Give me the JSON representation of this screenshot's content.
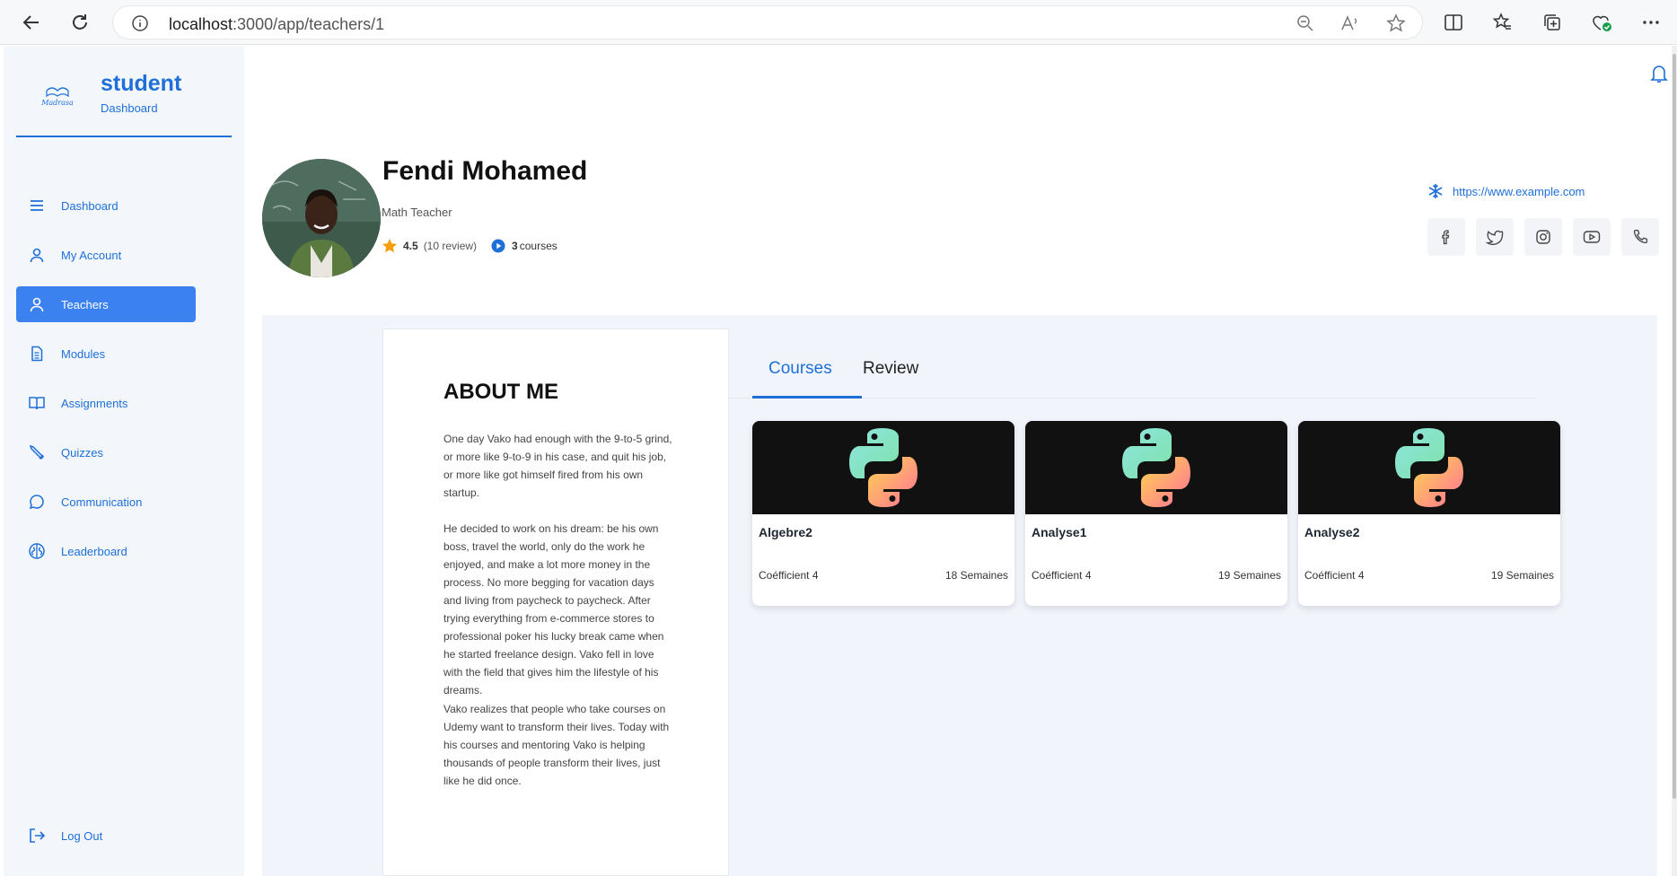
{
  "browser": {
    "url_host": "localhost",
    "url_path": ":3000/app/teachers/1"
  },
  "sidebar": {
    "brand_title": "student",
    "brand_subtitle": "Dashboard",
    "logo_text": "Madrasa",
    "items": [
      {
        "label": "Dashboard",
        "icon": "menu-icon"
      },
      {
        "label": "My Account",
        "icon": "user-icon"
      },
      {
        "label": "Teachers",
        "icon": "user-icon",
        "active": true
      },
      {
        "label": "Modules",
        "icon": "document-icon"
      },
      {
        "label": "Assignments",
        "icon": "book-icon"
      },
      {
        "label": "Quizzes",
        "icon": "pencil-icon"
      },
      {
        "label": "Communication",
        "icon": "chat-icon"
      },
      {
        "label": "Leaderboard",
        "icon": "trophy-icon"
      }
    ],
    "logout_label": "Log Out"
  },
  "teacher": {
    "name": "Fendi Mohamed",
    "role": "Math Teacher",
    "rating": "4.5",
    "reviews": "(10 review)",
    "course_count": "3",
    "courses_label": "courses",
    "website": "https://www.example.com"
  },
  "about": {
    "title": "ABOUT ME",
    "paragraphs": [
      "One day Vako had enough with the 9-to-5 grind, or more like 9-to-9 in his case, and quit his job, or more like got himself fired from his own startup.",
      "He decided to work on his dream: be his own boss, travel the world, only do the work he enjoyed, and make a lot more money in the process. No more begging for vacation days and living from paycheck to paycheck. After trying everything from e-commerce stores to professional poker his lucky break came when he started freelance design. Vako fell in love with the field that gives him the lifestyle of his dreams.",
      "Vako realizes that people who take courses on Udemy want to transform their lives. Today with his courses and mentoring Vako is helping thousands of people transform their lives, just like he did once."
    ]
  },
  "tabs": {
    "courses": "Courses",
    "review": "Review"
  },
  "courses": [
    {
      "title": "Algebre2",
      "coef": "Coéfficient 4",
      "weeks": "18 Semaines"
    },
    {
      "title": "Analyse1",
      "coef": "Coéfficient 4",
      "weeks": "19 Semaines"
    },
    {
      "title": "Analyse2",
      "coef": "Coéfficient 4",
      "weeks": "19 Semaines"
    }
  ],
  "colors": {
    "accent": "#1e6fd8",
    "active_menu": "#3b82f0",
    "star": "#f59e0b"
  }
}
